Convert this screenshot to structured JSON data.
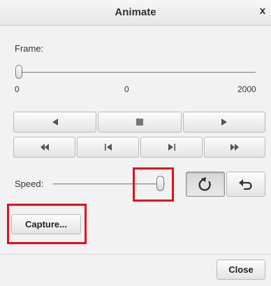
{
  "window": {
    "title": "Animate",
    "close_glyph": "x"
  },
  "frame": {
    "label": "Frame:",
    "min_label": "0",
    "current_label": "0",
    "max_label": "2000",
    "value": 0,
    "max": 2000
  },
  "playback": {
    "row1": [
      {
        "name": "play-backward-button",
        "icon": "play-backward-icon"
      },
      {
        "name": "stop-button",
        "icon": "stop-icon"
      },
      {
        "name": "play-forward-button",
        "icon": "play-forward-icon"
      }
    ],
    "row2": [
      {
        "name": "fast-backward-button",
        "icon": "fast-backward-icon"
      },
      {
        "name": "step-backward-button",
        "icon": "step-backward-icon"
      },
      {
        "name": "step-forward-button",
        "icon": "step-forward-icon"
      },
      {
        "name": "fast-forward-button",
        "icon": "fast-forward-icon"
      }
    ]
  },
  "speed": {
    "label": "Speed:",
    "level_fraction": 0.97
  },
  "loop_modes": [
    {
      "name": "loop-button",
      "icon": "loop-icon",
      "selected": true
    },
    {
      "name": "reverse-loop-button",
      "icon": "bounce-icon",
      "selected": false
    }
  ],
  "capture_label": "Capture...",
  "close_label": "Close",
  "colors": {
    "highlight": "#e0101a",
    "icon": "#555555"
  }
}
